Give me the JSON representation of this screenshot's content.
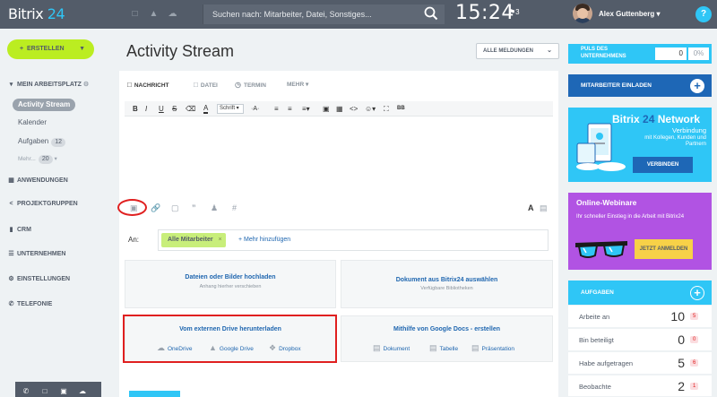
{
  "header": {
    "logo_text": "Bitrix",
    "logo_num": "24",
    "search_placeholder": "Suchen nach: Mitarbeiter, Datei, Sonstiges...",
    "time": "15:24",
    "flag_count": "3",
    "user_name": "Alex Guttenberg",
    "user_chevron": "▾",
    "help": "?"
  },
  "sidebar": {
    "create_label": "ERSTELLEN",
    "sections": [
      {
        "label": "MEIN ARBEITSPLATZ"
      },
      {
        "label": "ANWENDUNGEN"
      },
      {
        "label": "PROJEKTGRUPPEN"
      },
      {
        "label": "CRM"
      },
      {
        "label": "UNTERNEHMEN"
      },
      {
        "label": "EINSTELLUNGEN"
      },
      {
        "label": "TELEFONIE"
      }
    ],
    "items": [
      {
        "label": "Activity Stream"
      },
      {
        "label": "Kalender"
      },
      {
        "label": "Aufgaben",
        "badge": "12"
      },
      {
        "label": "Mehr...",
        "badge": "20"
      }
    ]
  },
  "main": {
    "title": "Activity Stream",
    "filter_label": "ALLE MELDUNGEN",
    "tabs": [
      {
        "label": "NACHRICHT"
      },
      {
        "label": "DATEI"
      },
      {
        "label": "TERMIN"
      },
      {
        "label": "MEHR"
      }
    ],
    "font_select": "Schrift",
    "recipients_label": "An:",
    "recipient_chip": "Alle Mitarbeiter",
    "add_more": "+ Mehr hinzufügen",
    "upload": {
      "local_title": "Dateien oder Bilder hochladen",
      "local_sub": "Anhang hierher verschieben",
      "b24_title": "Dokument aus Bitrix24 auswählen",
      "b24_sub": "Verfügbare Bibliotheken",
      "ext_title": "Vom externen Drive herunterladen",
      "ext_services": [
        "OneDrive",
        "Google Drive",
        "Dropbox"
      ],
      "gdocs_title": "Mithilfe von Google Docs - erstellen",
      "gdocs_items": [
        "Dokument",
        "Tabelle",
        "Präsentation"
      ]
    }
  },
  "right": {
    "puls_title": "PULS DES UNTERNEHMENS",
    "puls_value": "0",
    "puls_percent": "0%",
    "invite_label": "MITARBEITER EINLADEN",
    "network": {
      "title_a": "Bitrix",
      "title_num": "24",
      "title_b": "Network",
      "sub_big": "Verbindung",
      "sub_small": "mit Kollegen, Kunden und Partnern",
      "button": "VERBINDEN"
    },
    "webinar": {
      "title": "Online-Webinare",
      "sub": "Ihr schneller Einstieg in die Arbeit mit Bitrix24",
      "button": "JETZT ANMELDEN"
    },
    "tasks_title": "AUFGABEN",
    "tasks": [
      {
        "label": "Arbeite an",
        "count": "10",
        "badge": "5"
      },
      {
        "label": "Bin beteiligt",
        "count": "0",
        "badge": "0"
      },
      {
        "label": "Habe aufgetragen",
        "count": "5",
        "badge": "6"
      },
      {
        "label": "Beobachte",
        "count": "2",
        "badge": "1"
      }
    ]
  }
}
